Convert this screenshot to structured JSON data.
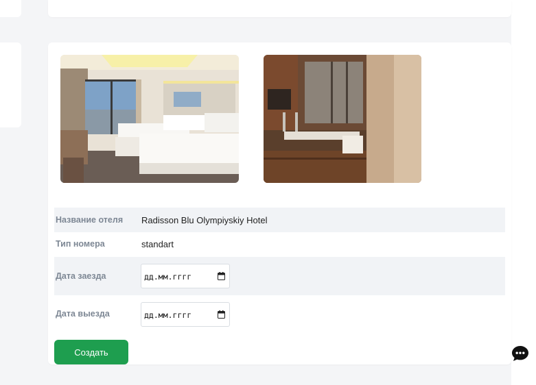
{
  "booking": {
    "hotel_name_label": "Название отеля",
    "hotel_name_value": "Radisson Blu Olympiyskiy Hotel",
    "room_type_label": "Тип номера",
    "room_type_value": "standart",
    "checkin_label": "Дата заезда",
    "checkin_placeholder": "дд.мм.гггг",
    "checkout_label": "Дата выезда",
    "checkout_placeholder": "дд.мм.гггг",
    "submit_label": "Создать"
  },
  "icons": {
    "calendar": "calendar-icon",
    "chat": "chat-bubble-icon"
  },
  "colors": {
    "accent": "#1e9e4f",
    "row_shade": "#f1f3f6",
    "label": "#7d8794",
    "background": "#f4f5f7"
  }
}
